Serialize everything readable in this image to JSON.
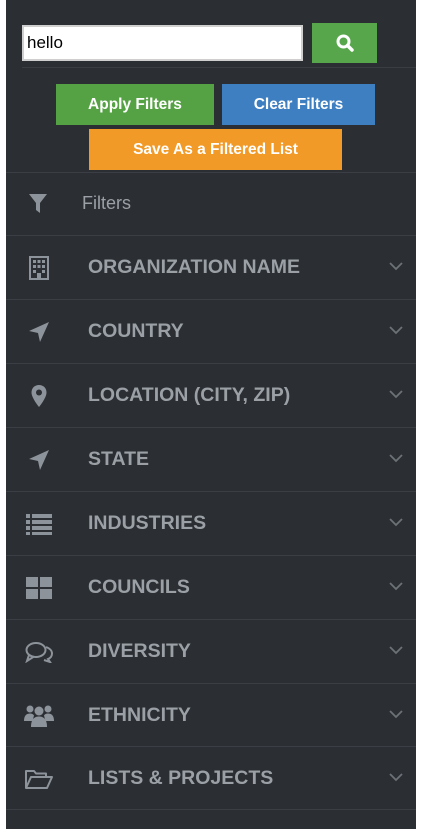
{
  "search": {
    "value": "hello",
    "button_icon": "search-icon"
  },
  "buttons": {
    "apply": "Apply Filters",
    "clear": "Clear Filters",
    "save": "Save As a Filtered List"
  },
  "filters_header": {
    "label": "Filters",
    "icon": "funnel-icon"
  },
  "items": [
    {
      "label": "ORGANIZATION NAME",
      "icon": "building-icon"
    },
    {
      "label": "COUNTRY",
      "icon": "location-arrow-icon"
    },
    {
      "label": "LOCATION (CITY, ZIP)",
      "icon": "map-marker-icon"
    },
    {
      "label": "STATE",
      "icon": "location-arrow-icon"
    },
    {
      "label": "INDUSTRIES",
      "icon": "list-icon"
    },
    {
      "label": "COUNCILS",
      "icon": "grid-icon"
    },
    {
      "label": "DIVERSITY",
      "icon": "comments-icon"
    },
    {
      "label": "ETHNICITY",
      "icon": "users-icon"
    },
    {
      "label": "LISTS & PROJECTS",
      "icon": "folder-open-icon"
    }
  ],
  "colors": {
    "panel_bg": "#2b2e33",
    "text_muted": "#9aa0a6",
    "apply_green": "#55a245",
    "clear_blue": "#3e7fc2",
    "save_orange": "#f29a27",
    "search_green": "#57a64b"
  }
}
